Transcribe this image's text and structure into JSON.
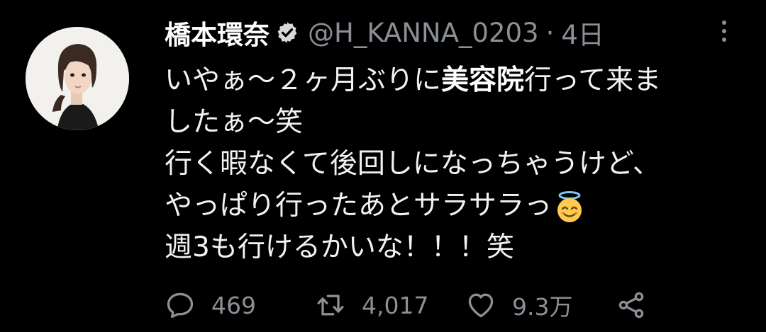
{
  "author": {
    "display_name": "橋本環奈",
    "handle": "@H_KANNA_0203",
    "separator": "·",
    "time_ago": "4日"
  },
  "tweet": {
    "line1_pre": "いやぁ〜２ヶ月ぶりに",
    "line1_bold": "美容院",
    "line1_post": "行って来ま",
    "line2": "したぁ〜笑",
    "line3": "行く暇なくて後回しになっちゃうけど、",
    "line4": "やっぱり行ったあとサラサラっ",
    "line5": "週3も行けるかいな！！！笑"
  },
  "stats": {
    "replies": "469",
    "retweets": "4,017",
    "likes": "9.3万"
  },
  "icons": {
    "verified": "verified-badge-icon",
    "more": "more-vertical-icon",
    "reply": "reply-icon",
    "retweet": "retweet-icon",
    "like": "heart-icon",
    "share": "share-icon",
    "emoji": "smiling-face-with-halo-emoji"
  },
  "colors": {
    "background": "#000000",
    "text": "#e7e9ea",
    "muted": "#8b9096"
  }
}
